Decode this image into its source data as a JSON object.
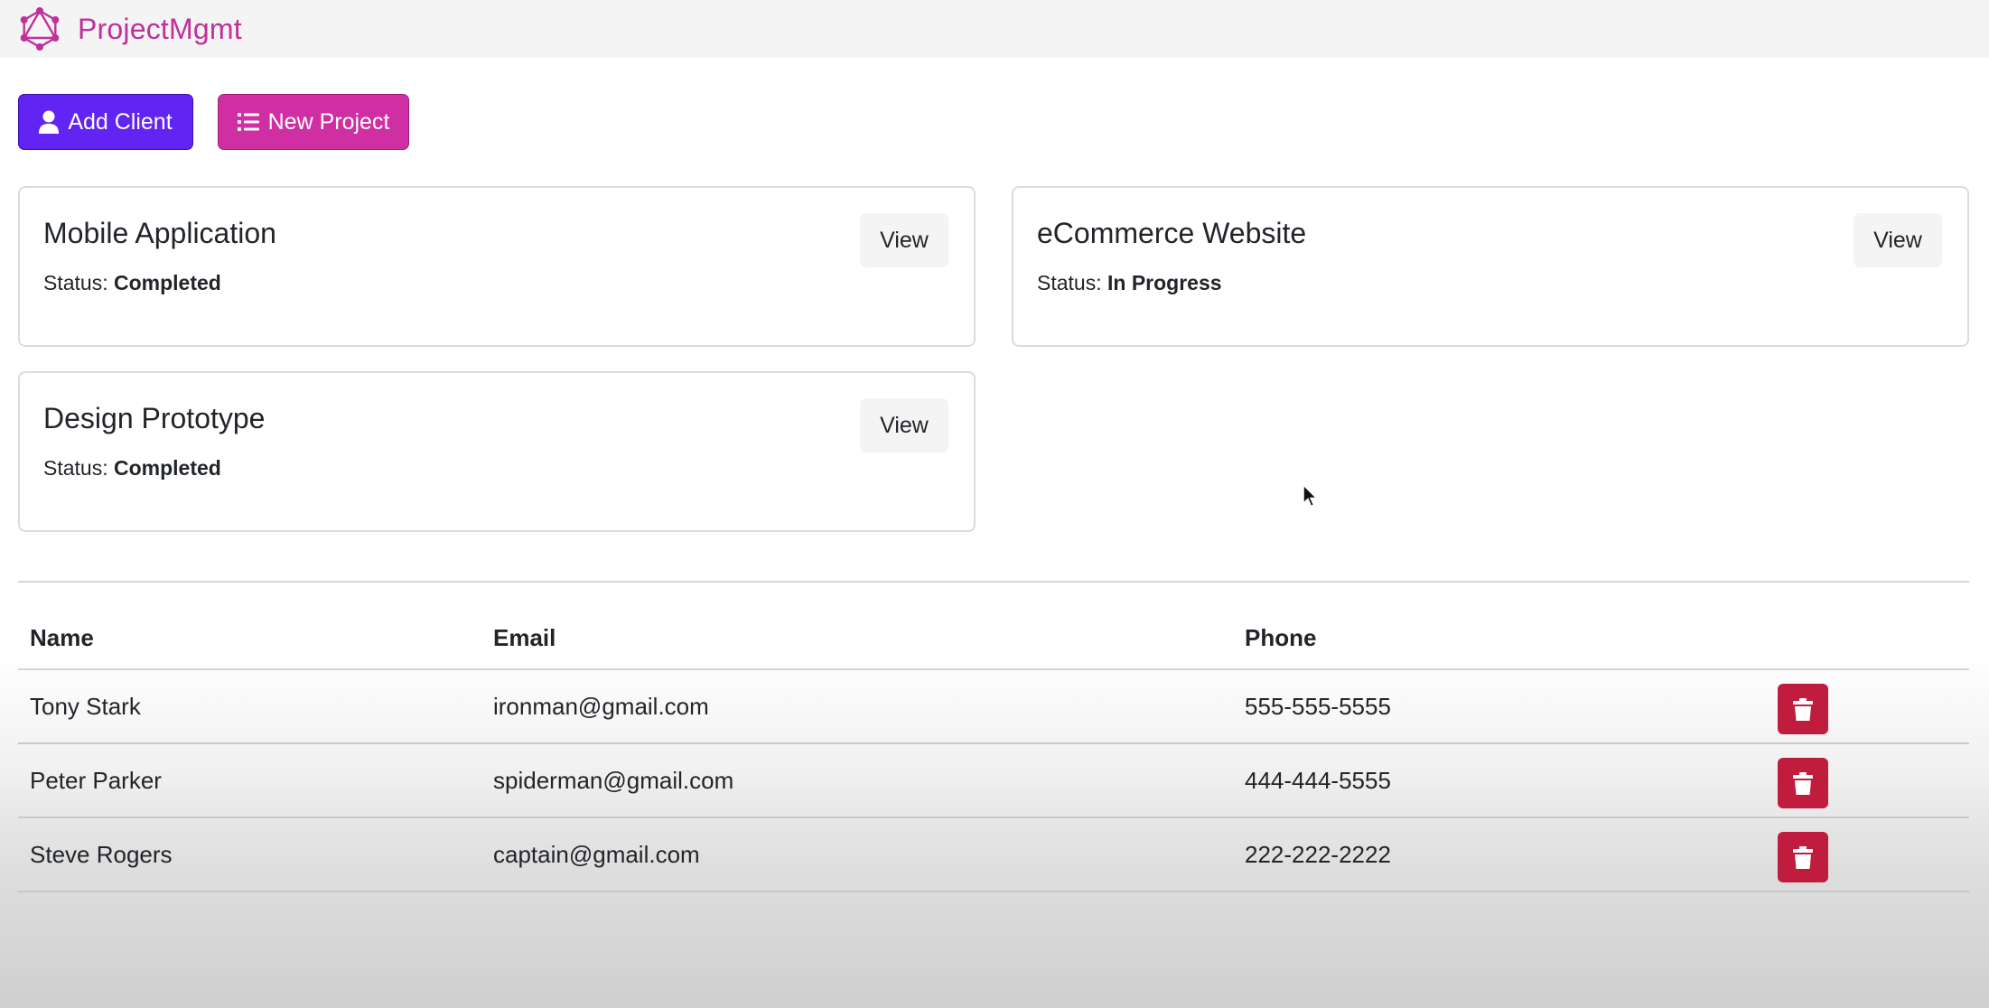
{
  "app": {
    "title": "ProjectMgmt",
    "logo_icon": "graphql-logo-icon",
    "brand_color": "#c0309a"
  },
  "actions": {
    "add_client_label": "Add Client",
    "add_client_icon": "user-icon",
    "add_client_color": "#6224f2",
    "new_project_label": "New Project",
    "new_project_icon": "list-icon",
    "new_project_color": "#d02ea3"
  },
  "projects": [
    {
      "name": "Mobile Application",
      "status_label": "Status:",
      "status": "Completed",
      "view_label": "View"
    },
    {
      "name": "eCommerce Website",
      "status_label": "Status:",
      "status": "In Progress",
      "view_label": "View"
    },
    {
      "name": "Design Prototype",
      "status_label": "Status:",
      "status": "Completed",
      "view_label": "View"
    }
  ],
  "clients_table": {
    "headers": [
      "Name",
      "Email",
      "Phone",
      ""
    ],
    "rows": [
      {
        "name": "Tony Stark",
        "email": "ironman@gmail.com",
        "phone": "555-555-5555",
        "delete_icon": "trash-icon"
      },
      {
        "name": "Peter Parker",
        "email": "spiderman@gmail.com",
        "phone": "444-444-5555",
        "delete_icon": "trash-icon"
      },
      {
        "name": "Steve Rogers",
        "email": "captain@gmail.com",
        "phone": "222-222-2222",
        "delete_icon": "trash-icon"
      }
    ],
    "delete_color": "#c01c3e"
  }
}
